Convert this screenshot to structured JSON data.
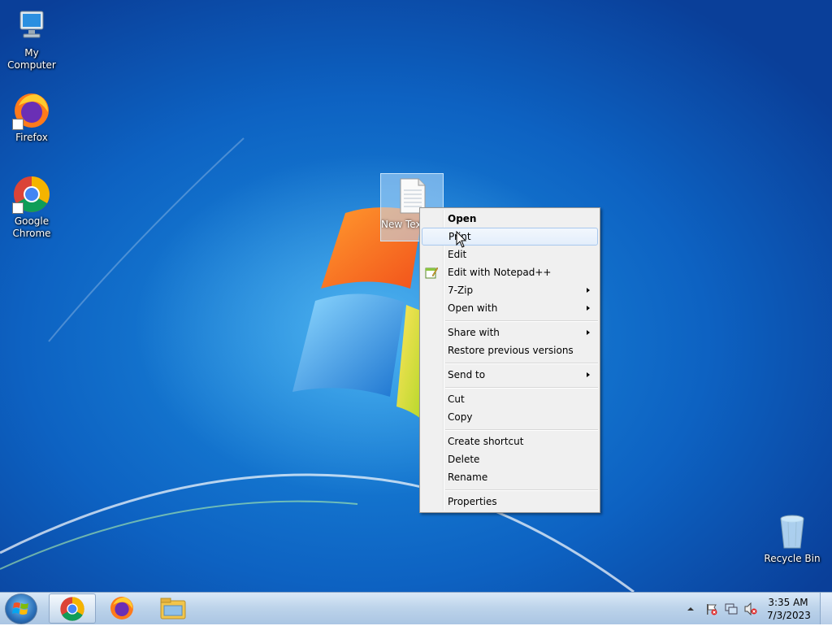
{
  "desktop": {
    "icons": [
      {
        "label": "My Computer"
      },
      {
        "label": "Firefox"
      },
      {
        "label": "Google Chrome"
      },
      {
        "label": "Recycle Bin"
      }
    ],
    "selected_file": {
      "label": "New Text Document"
    }
  },
  "context_menu": {
    "items": [
      {
        "label": "Open",
        "bold": true
      },
      {
        "label": "Print",
        "hover": true
      },
      {
        "label": "Edit"
      },
      {
        "label": "Edit with Notepad++",
        "icon": "notepad-plus-plus-icon"
      },
      {
        "label": "7-Zip",
        "submenu": true
      },
      {
        "label": "Open with",
        "submenu": true
      },
      {
        "label": "Share with",
        "submenu": true
      },
      {
        "label": "Restore previous versions"
      },
      {
        "label": "Send to",
        "submenu": true
      },
      {
        "label": "Cut"
      },
      {
        "label": "Copy"
      },
      {
        "label": "Create shortcut"
      },
      {
        "label": "Delete"
      },
      {
        "label": "Rename"
      },
      {
        "label": "Properties"
      }
    ]
  },
  "taskbar": {
    "pinned": [
      "chrome-icon",
      "firefox-icon",
      "file-explorer-icon"
    ],
    "tray_icons": [
      "show-hidden-icons-chevron",
      "action-center-flag-icon",
      "network-icon",
      "volume-muted-icon"
    ],
    "clock": {
      "time": "3:35 AM",
      "date": "7/3/2023"
    }
  },
  "colors": {
    "desktop_blue": "#0d62c2",
    "menu_bg": "#f0f0f0",
    "menu_hover": "#e3eefb"
  }
}
